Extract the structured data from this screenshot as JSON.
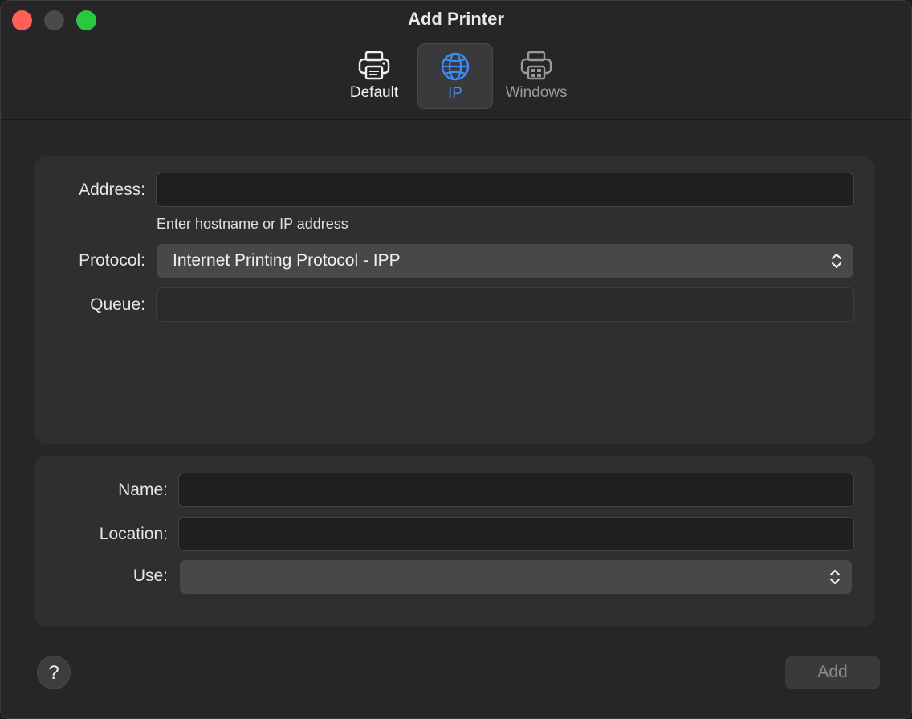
{
  "window": {
    "title": "Add Printer"
  },
  "tabs": [
    {
      "label": "Default",
      "icon": "printer-icon",
      "selected": false
    },
    {
      "label": "IP",
      "icon": "globe-icon",
      "selected": true
    },
    {
      "label": "Windows",
      "icon": "windows-printer-icon",
      "selected": false
    }
  ],
  "address": {
    "label": "Address:",
    "value": "",
    "hint": "Enter hostname or IP address"
  },
  "protocol": {
    "label": "Protocol:",
    "selected": "Internet Printing Protocol - IPP"
  },
  "queue": {
    "label": "Queue:",
    "value": ""
  },
  "name": {
    "label": "Name:",
    "value": ""
  },
  "location": {
    "label": "Location:",
    "value": ""
  },
  "use": {
    "label": "Use:",
    "selected": ""
  },
  "buttons": {
    "help": "?",
    "add": "Add"
  },
  "colors": {
    "accent": "#3f8cf4",
    "close": "#fe5f57",
    "maximize": "#28c840"
  }
}
